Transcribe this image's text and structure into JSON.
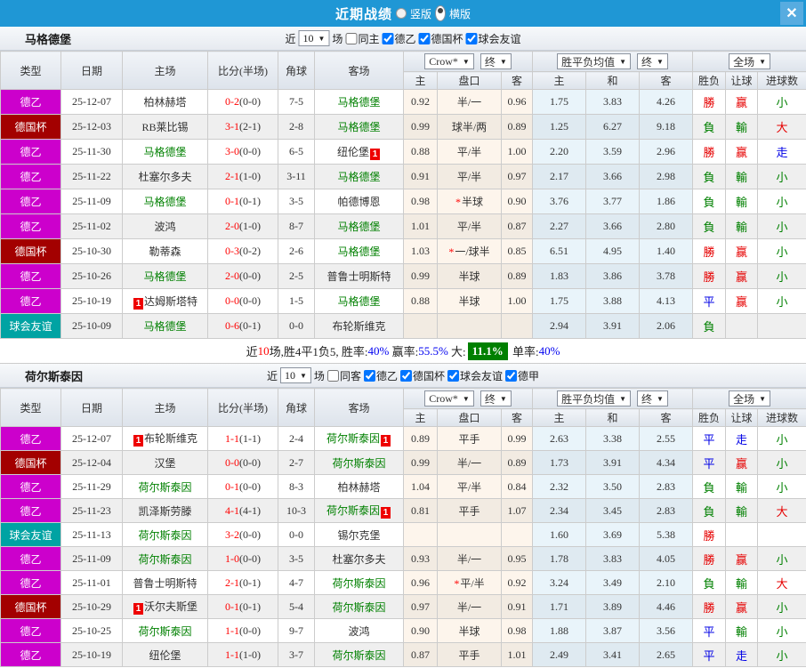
{
  "header": {
    "title": "近期战绩",
    "radio_vertical": "竖版",
    "radio_horizontal": "横版",
    "selected_layout": "横版",
    "close_label": "✕",
    "accent_blue": "#1f97d5"
  },
  "columns": {
    "type": "类型",
    "date": "日期",
    "home": "主场",
    "score": "比分(半场)",
    "corner": "角球",
    "away": "客场",
    "odds_provider": "Crow*",
    "final": "终",
    "mean": "胜平负均值",
    "full": "全场",
    "sub_home": "主",
    "sub_handicap": "盘口",
    "sub_away": "客",
    "sub_mean_home": "主",
    "sub_mean_draw": "和",
    "sub_mean_away": "客",
    "sub_result": "胜负",
    "sub_let": "让球",
    "sub_goals": "进球数"
  },
  "colors": {
    "league_de2": "#cc00cc",
    "league_cup": "#a30000",
    "league_friendly": "#00a3a3",
    "team_green": "#008000",
    "score_red": "#ff0000",
    "win_red": "#e60000",
    "loss_green": "#008000",
    "draw_blue": "#0000e6",
    "rate_blue": "#0000f0",
    "big_badge_green": "#008000"
  },
  "sections": [
    {
      "team": "马格德堡",
      "filter": {
        "near_label": "近",
        "count": "10",
        "matches_label": "场",
        "same_label": "同主",
        "same_checked": false,
        "leagues": [
          {
            "label": "德乙",
            "checked": true
          },
          {
            "label": "德国杯",
            "checked": true
          },
          {
            "label": "球会友谊",
            "checked": true
          }
        ]
      },
      "rows": [
        {
          "type": "德乙",
          "date": "25-12-07",
          "home": "柏林赫塔",
          "home_green": false,
          "home_badge": "",
          "score": "0-2",
          "half": "(0-0)",
          "corner": "7-5",
          "away": "马格德堡",
          "away_green": true,
          "away_badge": "",
          "oh": "0.92",
          "hand": "半/一",
          "star": false,
          "oa": "0.96",
          "mh": "1.75",
          "md": "3.83",
          "ma": "4.26",
          "res": "勝",
          "res_c": "r",
          "let": "赢",
          "let_c": "r",
          "goal": "小",
          "goal_c": "g"
        },
        {
          "type": "德国杯",
          "date": "25-12-03",
          "home": "RB莱比锡",
          "home_green": false,
          "home_badge": "",
          "score": "3-1",
          "half": "(2-1)",
          "corner": "2-8",
          "away": "马格德堡",
          "away_green": true,
          "away_badge": "",
          "oh": "0.99",
          "hand": "球半/两",
          "star": false,
          "oa": "0.89",
          "mh": "1.25",
          "md": "6.27",
          "ma": "9.18",
          "res": "負",
          "res_c": "g",
          "let": "輸",
          "let_c": "g",
          "goal": "大",
          "goal_c": "r"
        },
        {
          "type": "德乙",
          "date": "25-11-30",
          "home": "马格德堡",
          "home_green": true,
          "home_badge": "",
          "score": "3-0",
          "half": "(0-0)",
          "corner": "6-5",
          "away": "纽伦堡",
          "away_green": false,
          "away_badge": "1",
          "oh": "0.88",
          "hand": "平/半",
          "star": false,
          "oa": "1.00",
          "mh": "2.20",
          "md": "3.59",
          "ma": "2.96",
          "res": "勝",
          "res_c": "r",
          "let": "赢",
          "let_c": "r",
          "goal": "走",
          "goal_c": "b"
        },
        {
          "type": "德乙",
          "date": "25-11-22",
          "home": "杜塞尔多夫",
          "home_green": false,
          "home_badge": "",
          "score": "2-1",
          "half": "(1-0)",
          "corner": "3-11",
          "away": "马格德堡",
          "away_green": true,
          "away_badge": "",
          "oh": "0.91",
          "hand": "平/半",
          "star": false,
          "oa": "0.97",
          "mh": "2.17",
          "md": "3.66",
          "ma": "2.98",
          "res": "負",
          "res_c": "g",
          "let": "輸",
          "let_c": "g",
          "goal": "小",
          "goal_c": "g"
        },
        {
          "type": "德乙",
          "date": "25-11-09",
          "home": "马格德堡",
          "home_green": true,
          "home_badge": "",
          "score": "0-1",
          "half": "(0-1)",
          "corner": "3-5",
          "away": "帕德博恩",
          "away_green": false,
          "away_badge": "",
          "oh": "0.98",
          "hand": "半球",
          "star": true,
          "oa": "0.90",
          "mh": "3.76",
          "md": "3.77",
          "ma": "1.86",
          "res": "負",
          "res_c": "g",
          "let": "輸",
          "let_c": "g",
          "goal": "小",
          "goal_c": "g"
        },
        {
          "type": "德乙",
          "date": "25-11-02",
          "home": "波鸿",
          "home_green": false,
          "home_badge": "",
          "score": "2-0",
          "half": "(1-0)",
          "corner": "8-7",
          "away": "马格德堡",
          "away_green": true,
          "away_badge": "",
          "oh": "1.01",
          "hand": "平/半",
          "star": false,
          "oa": "0.87",
          "mh": "2.27",
          "md": "3.66",
          "ma": "2.80",
          "res": "負",
          "res_c": "g",
          "let": "輸",
          "let_c": "g",
          "goal": "小",
          "goal_c": "g"
        },
        {
          "type": "德国杯",
          "date": "25-10-30",
          "home": "勒蒂森",
          "home_green": false,
          "home_badge": "",
          "score": "0-3",
          "half": "(0-2)",
          "corner": "2-6",
          "away": "马格德堡",
          "away_green": true,
          "away_badge": "",
          "oh": "1.03",
          "hand": "一/球半",
          "star": true,
          "oa": "0.85",
          "mh": "6.51",
          "md": "4.95",
          "ma": "1.40",
          "res": "勝",
          "res_c": "r",
          "let": "赢",
          "let_c": "r",
          "goal": "小",
          "goal_c": "g"
        },
        {
          "type": "德乙",
          "date": "25-10-26",
          "home": "马格德堡",
          "home_green": true,
          "home_badge": "",
          "score": "2-0",
          "half": "(0-0)",
          "corner": "2-5",
          "away": "普鲁士明斯特",
          "away_green": false,
          "away_badge": "",
          "oh": "0.99",
          "hand": "半球",
          "star": false,
          "oa": "0.89",
          "mh": "1.83",
          "md": "3.86",
          "ma": "3.78",
          "res": "勝",
          "res_c": "r",
          "let": "赢",
          "let_c": "r",
          "goal": "小",
          "goal_c": "g"
        },
        {
          "type": "德乙",
          "date": "25-10-19",
          "home": "达姆斯塔特",
          "home_green": false,
          "home_badge": "1",
          "score": "0-0",
          "half": "(0-0)",
          "corner": "1-5",
          "away": "马格德堡",
          "away_green": true,
          "away_badge": "",
          "oh": "0.88",
          "hand": "半球",
          "star": false,
          "oa": "1.00",
          "mh": "1.75",
          "md": "3.88",
          "ma": "4.13",
          "res": "平",
          "res_c": "b",
          "let": "赢",
          "let_c": "r",
          "goal": "小",
          "goal_c": "g"
        },
        {
          "type": "球会友谊",
          "date": "25-10-09",
          "home": "马格德堡",
          "home_green": true,
          "home_badge": "",
          "score": "0-6",
          "half": "(0-1)",
          "corner": "0-0",
          "away": "布轮斯维克",
          "away_green": false,
          "away_badge": "",
          "oh": "",
          "hand": "",
          "star": false,
          "oa": "",
          "mh": "2.94",
          "md": "3.91",
          "ma": "2.06",
          "res": "負",
          "res_c": "g",
          "let": "",
          "let_c": "",
          "goal": "",
          "goal_c": ""
        }
      ],
      "summary": {
        "near": "近",
        "count": "10",
        "record": "场,胜4平1负5, 胜率:",
        "win_rate": "40%",
        "ying_label": " 赢率:",
        "ying_rate": "55.5%",
        "big_label": " 大:",
        "big_rate": "11.1%",
        "dan_label": " 单率:",
        "dan_rate": "40%"
      }
    },
    {
      "team": "荷尔斯泰因",
      "filter": {
        "near_label": "近",
        "count": "10",
        "matches_label": "场",
        "same_label": "同客",
        "same_checked": false,
        "leagues": [
          {
            "label": "德乙",
            "checked": true
          },
          {
            "label": "德国杯",
            "checked": true
          },
          {
            "label": "球会友谊",
            "checked": true
          },
          {
            "label": "德甲",
            "checked": true
          }
        ]
      },
      "rows": [
        {
          "type": "德乙",
          "date": "25-12-07",
          "home": "布轮斯维克",
          "home_green": false,
          "home_badge": "1",
          "score": "1-1",
          "half": "(1-1)",
          "corner": "2-4",
          "away": "荷尔斯泰因",
          "away_green": true,
          "away_badge": "1",
          "oh": "0.89",
          "hand": "平手",
          "star": false,
          "oa": "0.99",
          "mh": "2.63",
          "md": "3.38",
          "ma": "2.55",
          "res": "平",
          "res_c": "b",
          "let": "走",
          "let_c": "b",
          "goal": "小",
          "goal_c": "g"
        },
        {
          "type": "德国杯",
          "date": "25-12-04",
          "home": "汉堡",
          "home_green": false,
          "home_badge": "",
          "score": "0-0",
          "half": "(0-0)",
          "corner": "2-7",
          "away": "荷尔斯泰因",
          "away_green": true,
          "away_badge": "",
          "oh": "0.99",
          "hand": "半/一",
          "star": false,
          "oa": "0.89",
          "mh": "1.73",
          "md": "3.91",
          "ma": "4.34",
          "res": "平",
          "res_c": "b",
          "let": "赢",
          "let_c": "r",
          "goal": "小",
          "goal_c": "g"
        },
        {
          "type": "德乙",
          "date": "25-11-29",
          "home": "荷尔斯泰因",
          "home_green": true,
          "home_badge": "",
          "score": "0-1",
          "half": "(0-0)",
          "corner": "8-3",
          "away": "柏林赫塔",
          "away_green": false,
          "away_badge": "",
          "oh": "1.04",
          "hand": "平/半",
          "star": false,
          "oa": "0.84",
          "mh": "2.32",
          "md": "3.50",
          "ma": "2.83",
          "res": "負",
          "res_c": "g",
          "let": "輸",
          "let_c": "g",
          "goal": "小",
          "goal_c": "g"
        },
        {
          "type": "德乙",
          "date": "25-11-23",
          "home": "凯泽斯劳滕",
          "home_green": false,
          "home_badge": "",
          "score": "4-1",
          "half": "(4-1)",
          "corner": "10-3",
          "away": "荷尔斯泰因",
          "away_green": true,
          "away_badge": "1",
          "oh": "0.81",
          "hand": "平手",
          "star": false,
          "oa": "1.07",
          "mh": "2.34",
          "md": "3.45",
          "ma": "2.83",
          "res": "負",
          "res_c": "g",
          "let": "輸",
          "let_c": "g",
          "goal": "大",
          "goal_c": "r"
        },
        {
          "type": "球会友谊",
          "date": "25-11-13",
          "home": "荷尔斯泰因",
          "home_green": true,
          "home_badge": "",
          "score": "3-2",
          "half": "(0-0)",
          "corner": "0-0",
          "away": "锡尔克堡",
          "away_green": false,
          "away_badge": "",
          "oh": "",
          "hand": "",
          "star": false,
          "oa": "",
          "mh": "1.60",
          "md": "3.69",
          "ma": "5.38",
          "res": "勝",
          "res_c": "r",
          "let": "",
          "let_c": "",
          "goal": "",
          "goal_c": ""
        },
        {
          "type": "德乙",
          "date": "25-11-09",
          "home": "荷尔斯泰因",
          "home_green": true,
          "home_badge": "",
          "score": "1-0",
          "half": "(0-0)",
          "corner": "3-5",
          "away": "杜塞尔多夫",
          "away_green": false,
          "away_badge": "",
          "oh": "0.93",
          "hand": "半/一",
          "star": false,
          "oa": "0.95",
          "mh": "1.78",
          "md": "3.83",
          "ma": "4.05",
          "res": "勝",
          "res_c": "r",
          "let": "赢",
          "let_c": "r",
          "goal": "小",
          "goal_c": "g"
        },
        {
          "type": "德乙",
          "date": "25-11-01",
          "home": "普鲁士明斯特",
          "home_green": false,
          "home_badge": "",
          "score": "2-1",
          "half": "(0-1)",
          "corner": "4-7",
          "away": "荷尔斯泰因",
          "away_green": true,
          "away_badge": "",
          "oh": "0.96",
          "hand": "平/半",
          "star": true,
          "oa": "0.92",
          "mh": "3.24",
          "md": "3.49",
          "ma": "2.10",
          "res": "負",
          "res_c": "g",
          "let": "輸",
          "let_c": "g",
          "goal": "大",
          "goal_c": "r"
        },
        {
          "type": "德国杯",
          "date": "25-10-29",
          "home": "沃尔夫斯堡",
          "home_green": false,
          "home_badge": "1",
          "score": "0-1",
          "half": "(0-1)",
          "corner": "5-4",
          "away": "荷尔斯泰因",
          "away_green": true,
          "away_badge": "",
          "oh": "0.97",
          "hand": "半/一",
          "star": false,
          "oa": "0.91",
          "mh": "1.71",
          "md": "3.89",
          "ma": "4.46",
          "res": "勝",
          "res_c": "r",
          "let": "赢",
          "let_c": "r",
          "goal": "小",
          "goal_c": "g"
        },
        {
          "type": "德乙",
          "date": "25-10-25",
          "home": "荷尔斯泰因",
          "home_green": true,
          "home_badge": "",
          "score": "1-1",
          "half": "(0-0)",
          "corner": "9-7",
          "away": "波鸿",
          "away_green": false,
          "away_badge": "",
          "oh": "0.90",
          "hand": "半球",
          "star": false,
          "oa": "0.98",
          "mh": "1.88",
          "md": "3.87",
          "ma": "3.56",
          "res": "平",
          "res_c": "b",
          "let": "輸",
          "let_c": "g",
          "goal": "小",
          "goal_c": "g"
        },
        {
          "type": "德乙",
          "date": "25-10-19",
          "home": "纽伦堡",
          "home_green": false,
          "home_badge": "",
          "score": "1-1",
          "half": "(1-0)",
          "corner": "3-7",
          "away": "荷尔斯泰因",
          "away_green": true,
          "away_badge": "",
          "oh": "0.87",
          "hand": "平手",
          "star": false,
          "oa": "1.01",
          "mh": "2.49",
          "md": "3.41",
          "ma": "2.65",
          "res": "平",
          "res_c": "b",
          "let": "走",
          "let_c": "b",
          "goal": "小",
          "goal_c": "g"
        }
      ]
    }
  ]
}
